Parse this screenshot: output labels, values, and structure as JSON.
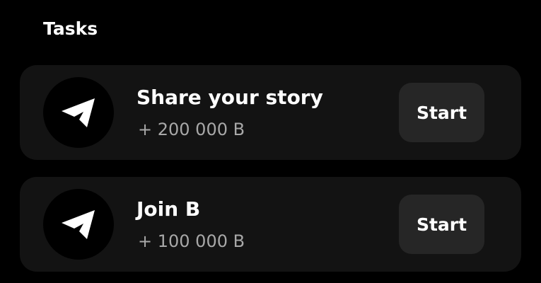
{
  "section": {
    "title": "Tasks"
  },
  "tasks": [
    {
      "title": "Share your story",
      "reward": "+ 200 000 B",
      "icon": "telegram-send-icon",
      "button_label": "Start"
    },
    {
      "title": "Join B",
      "reward": "+ 100 000 B",
      "icon": "telegram-send-icon",
      "button_label": "Start"
    }
  ],
  "colors": {
    "background": "#000000",
    "card": "#131313",
    "button": "#262626",
    "text": "#ffffff",
    "muted_text": "#a8a8a8"
  }
}
